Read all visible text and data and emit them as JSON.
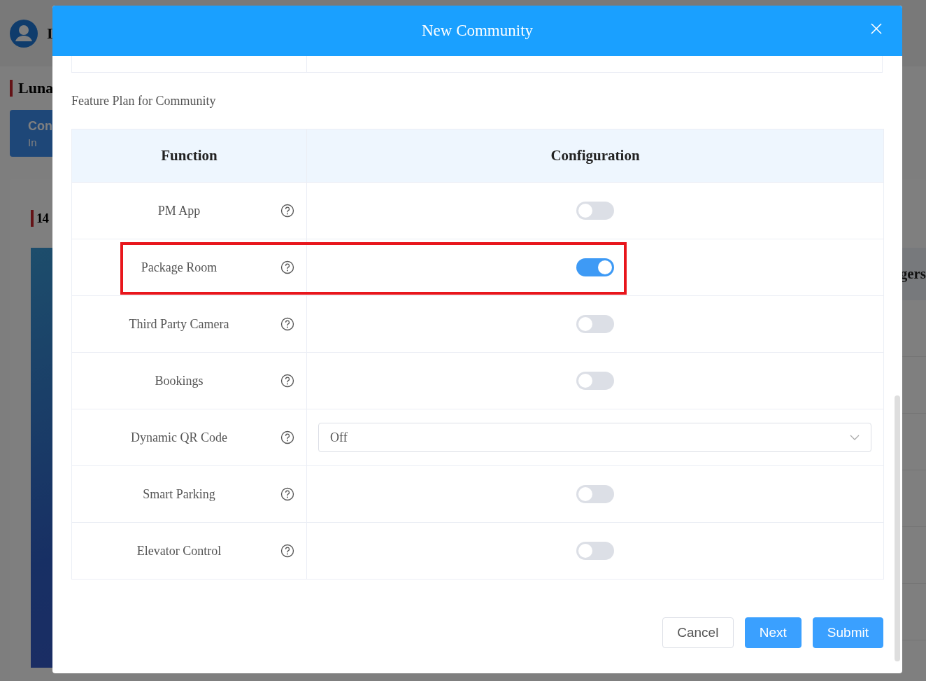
{
  "background": {
    "header_text": "I",
    "page_title": "Luna",
    "tile": {
      "title": "Con",
      "subtitle": "In"
    },
    "card_title": "14",
    "table_header": "gers"
  },
  "dialog": {
    "title": "New Community",
    "section_label": "Feature Plan for Community",
    "table": {
      "columns": [
        "Function",
        "Configuration"
      ],
      "rows": [
        {
          "function": "PM App",
          "kind": "toggle",
          "on": false,
          "highlighted": false
        },
        {
          "function": "Package Room",
          "kind": "toggle",
          "on": true,
          "highlighted": true
        },
        {
          "function": "Third Party Camera",
          "kind": "toggle",
          "on": false,
          "highlighted": false
        },
        {
          "function": "Bookings",
          "kind": "toggle",
          "on": false,
          "highlighted": false
        },
        {
          "function": "Dynamic QR Code",
          "kind": "select",
          "value": "Off",
          "highlighted": false
        },
        {
          "function": "Smart Parking",
          "kind": "toggle",
          "on": false,
          "highlighted": false
        },
        {
          "function": "Elevator Control",
          "kind": "toggle",
          "on": false,
          "highlighted": false
        }
      ]
    },
    "buttons": [
      {
        "label": "Cancel",
        "kind": "default"
      },
      {
        "label": "Next",
        "kind": "primary"
      },
      {
        "label": "Submit",
        "kind": "primary"
      }
    ]
  }
}
